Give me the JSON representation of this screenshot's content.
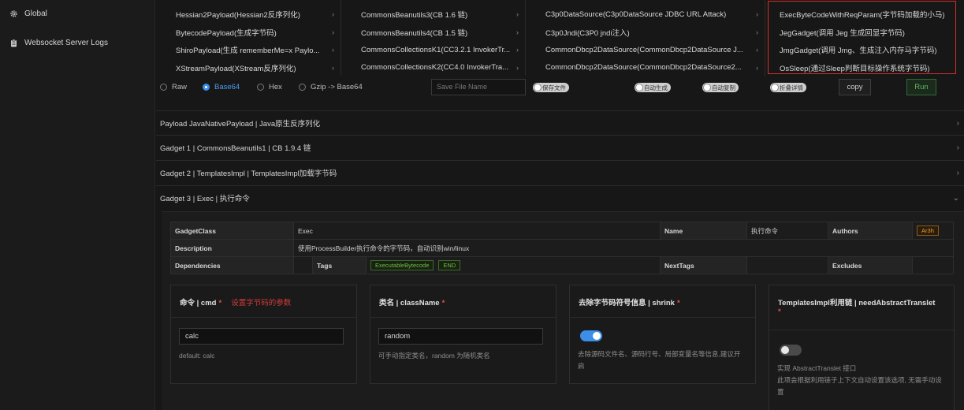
{
  "sidebar": {
    "items": [
      {
        "label": "Global",
        "icon": "gear-icon"
      },
      {
        "label": "Websocket Server Logs",
        "icon": "clipboard-icon"
      }
    ]
  },
  "gadget_columns": [
    [
      "Hessian2Payload(Hessian2反序列化)",
      "BytecodePayload(生成字节码)",
      "ShiroPayload(生成 rememberMe=x Paylo...",
      "XStreamPayload(XStream反序列化)"
    ],
    [
      "CommonsBeanutils3(CB 1.6 链)",
      "CommonsBeanutils4(CB 1.5 链)",
      "CommonsCollectionsK1(CC3.2.1 InvokerTr...",
      "CommonsCollectionsK2(CC4.0 InvokerTra..."
    ],
    [
      "C3p0DataSource(C3p0DataSource JDBC URL Attack)",
      "C3p0Jndi(C3P0 jndi注入)",
      "CommonDbcp2DataSource(CommonDbcp2DataSource J...",
      "CommonDbcp2DataSource(CommonDbcp2DataSource2..."
    ],
    [
      "ExecByteCodeWithReqParam(字节码加载的小马)",
      "JegGadget(调用 Jeg 生成回显字节码)",
      "JmgGadget(调用 Jmg、生成注入内存马字节码)",
      "OsSleep(通过Sleep判断目标操作系统字节码)"
    ]
  ],
  "encoding": {
    "options": [
      "Raw",
      "Base64",
      "Hex",
      "Gzip -> Base64"
    ],
    "selected": "Base64"
  },
  "save_file": {
    "placeholder": "Save File Name"
  },
  "toggles": {
    "save_file": "保存文件",
    "auto_generate": "自动生成",
    "auto_copy": "自动复制",
    "fold_details": "折叠详情"
  },
  "buttons": {
    "copy": "copy",
    "run": "Run"
  },
  "accordions": [
    "Payload JavaNativePayload | Java原生反序列化",
    "Gadget 1 | CommonsBeanutils1 | CB 1.9.4 链",
    "Gadget 2 | TemplatesImpl | TemplatesImpl加载字节码",
    "Gadget 3 | Exec | 执行命令"
  ],
  "info": {
    "gadget_class_label": "GadgetClass",
    "gadget_class": "Exec",
    "name_label": "Name",
    "name": "执行命令",
    "authors_label": "Authors",
    "author": "Ar3h",
    "description_label": "Description",
    "description": "使用ProcessBuilder执行命令的字节码，自动识别win/linux",
    "dependencies_label": "Dependencies",
    "tags_label": "Tags",
    "tags": [
      "ExecutableBytecode",
      "END"
    ],
    "next_tags_label": "NextTags",
    "excludes_label": "Excludes"
  },
  "params": [
    {
      "title": "命令 | cmd",
      "required": "*",
      "hint": "设置字节码的参数",
      "value": "calc",
      "help": "default: calc"
    },
    {
      "title": "类名 | className",
      "required": "*",
      "value": "random",
      "help": "可手动指定类名，random 为随机类名"
    },
    {
      "title": "去除字节码符号信息 | shrink",
      "required": "*",
      "switch_on": true,
      "help": "去除源码文件名、源码行号、局部变量名等信息,建议开启"
    },
    {
      "title": "TemplatesImpl利用链 | needAbstractTranslet",
      "required": "*",
      "switch_on": false,
      "help": "实现 AbstractTranslet 接口",
      "help2": "此项会根据利用链子上下文自动设置该选项, 无需手动设置"
    }
  ],
  "colors": {
    "accent": "#3d8ee6",
    "run": "#5cb85c",
    "highlight": "#d32f2f",
    "tag": "#73b94f",
    "author": "#e6a23c"
  }
}
